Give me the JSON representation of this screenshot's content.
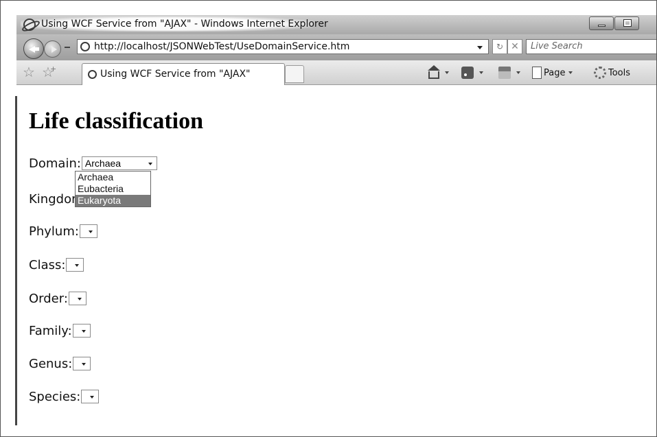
{
  "window": {
    "title": "Using WCF Service from \"AJAX\" - Windows Internet Explorer"
  },
  "addressbar": {
    "url": "http://localhost/JSONWebTest/UseDomainService.htm",
    "search_placeholder": "Live Search"
  },
  "tab": {
    "label": "Using WCF Service from \"AJAX\""
  },
  "commandbar": {
    "page_label": "Page",
    "tools_label": "Tools"
  },
  "page": {
    "heading": "Life classification",
    "fields": [
      {
        "label": "Domain:",
        "value": "Archaea"
      },
      {
        "label": "Kingdom:",
        "value": ""
      },
      {
        "label": "Phylum:",
        "value": ""
      },
      {
        "label": "Class:",
        "value": ""
      },
      {
        "label": "Order:",
        "value": ""
      },
      {
        "label": "Family:",
        "value": ""
      },
      {
        "label": "Genus:",
        "value": ""
      },
      {
        "label": "Species:",
        "value": ""
      }
    ],
    "domain_dropdown": {
      "options": [
        "Archaea",
        "Eubacteria",
        "Eukaryota"
      ],
      "highlighted": "Eukaryota"
    }
  }
}
